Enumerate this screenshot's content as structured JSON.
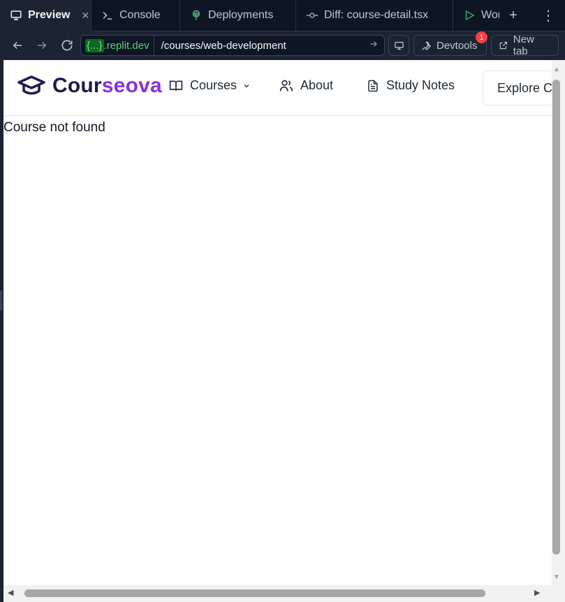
{
  "tabs": [
    {
      "label": "Preview",
      "icon": "monitor-icon",
      "active": true
    },
    {
      "label": "Console",
      "icon": "terminal-icon"
    },
    {
      "label": "Deployments",
      "icon": "deployments-icon"
    },
    {
      "label": "Diff: course-detail.tsx",
      "icon": "git-commit-icon"
    },
    {
      "label": "Wor",
      "icon": "play-icon"
    }
  ],
  "address": {
    "domain_tag": "{...}",
    "domain_host": ".replit.dev",
    "path": "/courses/web-development"
  },
  "toolbar": {
    "devtools_label": "Devtools",
    "devtools_badge": "1",
    "newtab_label": "New tab"
  },
  "site": {
    "logo_prefix": "Cour",
    "logo_suffix": "seova",
    "nav": {
      "courses": "Courses",
      "about": "About",
      "study_notes": "Study Notes"
    },
    "explore_label": "Explore C",
    "message": "Course not found"
  },
  "colors": {
    "accent_purple": "#8b2fd6",
    "logo_dark": "#1e1b4b",
    "ide_bg": "#1c2333",
    "domain_green": "#5fd17a",
    "badge_red": "#f23f42"
  }
}
